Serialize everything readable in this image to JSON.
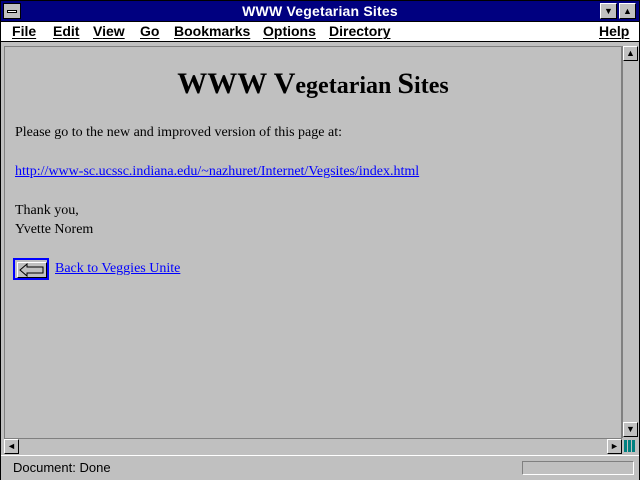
{
  "window": {
    "title": "WWW Vegetarian Sites"
  },
  "menu": {
    "items": [
      {
        "accel": "F",
        "rest": "ile"
      },
      {
        "accel": "E",
        "rest": "dit"
      },
      {
        "accel": "V",
        "rest": "iew"
      },
      {
        "accel": "G",
        "rest": "o"
      },
      {
        "accel": "B",
        "rest": "ookmarks"
      },
      {
        "accel": "O",
        "rest": "ptions"
      },
      {
        "accel": "D",
        "rest": "irectory"
      },
      {
        "accel": "H",
        "rest": "elp"
      }
    ]
  },
  "page": {
    "heading": {
      "w1": "WWW V",
      "w2": "egetarian ",
      "w3": "S",
      "w4": "ites"
    },
    "intro": "Please go to the new and improved version of this page at:",
    "new_url": "http://www-sc.ucssc.indiana.edu/~nazhuret/Internet/Vegsites/index.html",
    "thanks": "Thank you,",
    "signature": "Yvette Norem",
    "back_link": " Back to Veggies Unite"
  },
  "status": {
    "text": "Document: Done"
  }
}
